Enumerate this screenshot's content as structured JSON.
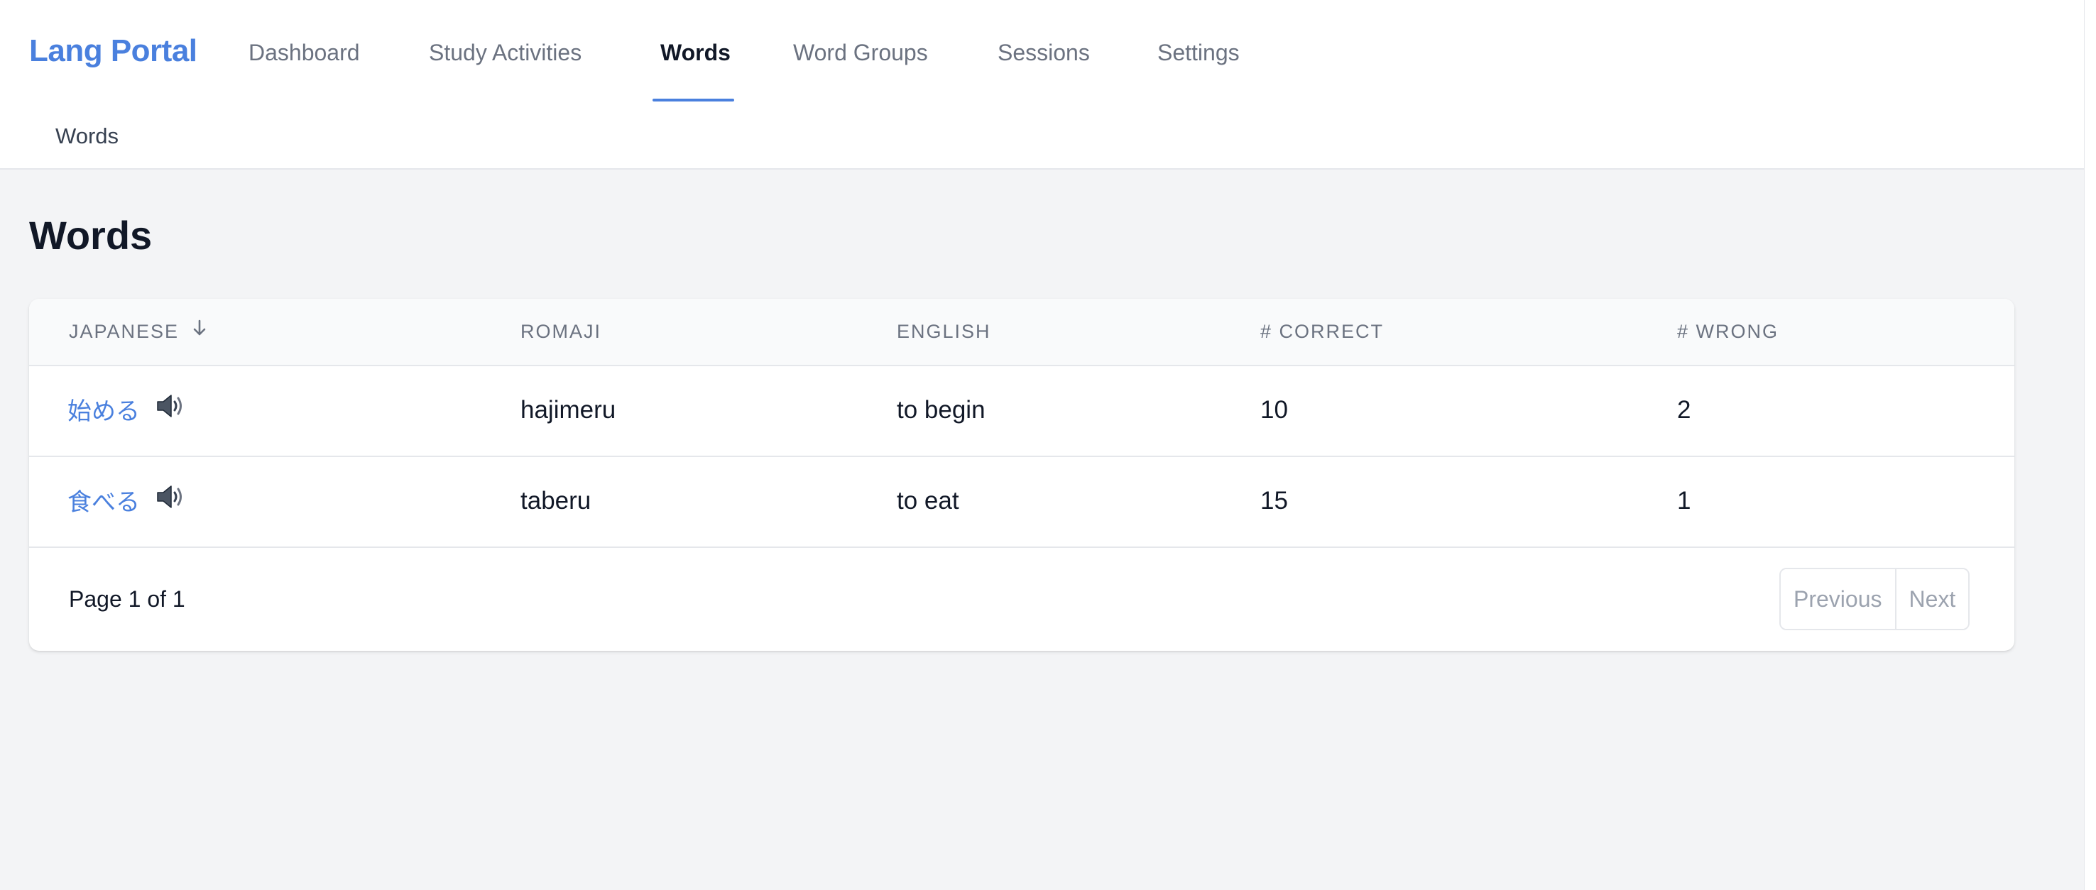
{
  "brand": "Lang Portal",
  "nav": {
    "items": [
      {
        "label": "Dashboard"
      },
      {
        "label": "Study Activities"
      },
      {
        "label": "Words"
      },
      {
        "label": "Word Groups"
      },
      {
        "label": "Sessions"
      },
      {
        "label": "Settings"
      }
    ],
    "active_index": 2
  },
  "breadcrumb": "Words",
  "page_title": "Words",
  "table": {
    "headers": [
      "JAPANESE",
      "ROMAJI",
      "ENGLISH",
      "# CORRECT",
      "# WRONG"
    ],
    "sort": {
      "column": "JAPANESE",
      "direction": "descending",
      "icon": "arrow-down-icon"
    },
    "rows": [
      {
        "japanese": "始める",
        "romaji": "hajimeru",
        "english": "to begin",
        "correct": "10",
        "wrong": "2",
        "icon": "speaker-icon"
      },
      {
        "japanese": "食べる",
        "romaji": "taberu",
        "english": "to eat",
        "correct": "15",
        "wrong": "1",
        "icon": "speaker-icon"
      }
    ]
  },
  "pagination": {
    "text": "Page 1 of 1",
    "previous_label": "Previous",
    "next_label": "Next"
  },
  "colors": {
    "accent": "#4a80de",
    "background": "#f3f4f6",
    "text": "#111827",
    "muted": "#6b7280",
    "border": "#e5e7eb"
  }
}
